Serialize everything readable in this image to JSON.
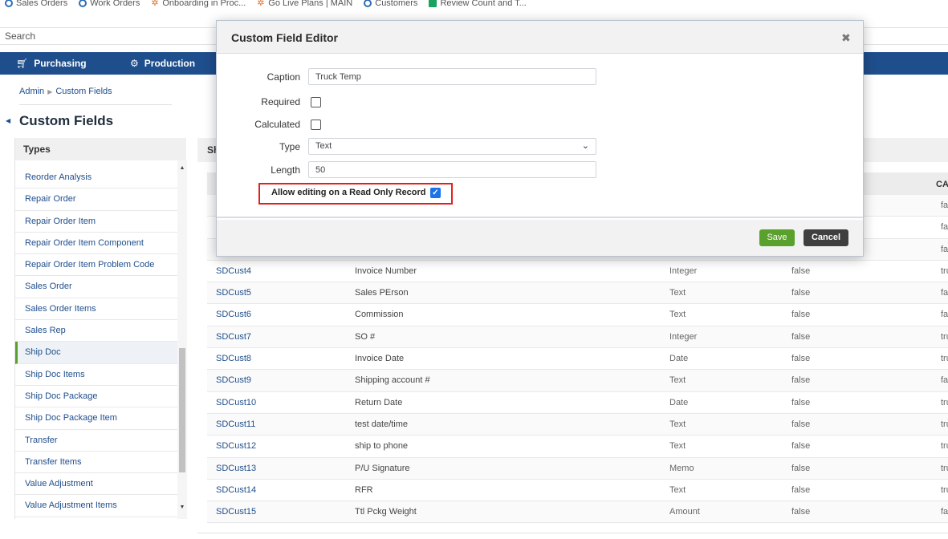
{
  "bookmarks": [
    {
      "label": "Sales Orders",
      "icon": "globe-icon"
    },
    {
      "label": "Work Orders",
      "icon": "globe-icon"
    },
    {
      "label": "Onboarding in Proc...",
      "icon": "asana-icon"
    },
    {
      "label": "Go Live Plans | MAIN",
      "icon": "asana-icon"
    },
    {
      "label": "Customers",
      "icon": "globe-icon"
    },
    {
      "label": "Review Count and T...",
      "icon": "sheets-icon"
    }
  ],
  "search": {
    "placeholder": "Search"
  },
  "nav": {
    "purchasing": {
      "label": "Purchasing",
      "icon": "cart-icon"
    },
    "production": {
      "label": "Production",
      "icon": "gears-icon"
    }
  },
  "breadcrumb": {
    "root": "Admin",
    "current": "Custom Fields"
  },
  "page_title": "Custom Fields",
  "types": {
    "header": "Types",
    "items": [
      "Reorder Analysis",
      "Repair Order",
      "Repair Order Item",
      "Repair Order Item Component",
      "Repair Order Item Problem Code",
      "Sales Order",
      "Sales Order Items",
      "Sales Rep",
      "Ship Doc",
      "Ship Doc Items",
      "Ship Doc Package",
      "Ship Doc Package Item",
      "Transfer",
      "Transfer Items",
      "Value Adjustment",
      "Value Adjustment Items"
    ],
    "active": "Ship Doc"
  },
  "right_panel": {
    "label_prefix": "Sh",
    "col_header_partial": "CAL"
  },
  "grid": {
    "rows": [
      {
        "field": "",
        "caption": "",
        "type": "",
        "required": "",
        "calculated": "fals"
      },
      {
        "field": "",
        "caption": "",
        "type": "",
        "required": "",
        "calculated": "fals"
      },
      {
        "field": "",
        "caption": "",
        "type": "",
        "required": "",
        "calculated": "fals"
      },
      {
        "field": "SDCust4",
        "caption": "Invoice Number",
        "type": "Integer",
        "required": "false",
        "calculated": "tru"
      },
      {
        "field": "SDCust5",
        "caption": "Sales PErson",
        "type": "Text",
        "required": "false",
        "calculated": "fals"
      },
      {
        "field": "SDCust6",
        "caption": "Commission",
        "type": "Text",
        "required": "false",
        "calculated": "fals"
      },
      {
        "field": "SDCust7",
        "caption": "SO #",
        "type": "Integer",
        "required": "false",
        "calculated": "tru"
      },
      {
        "field": "SDCust8",
        "caption": "Invoice Date",
        "type": "Date",
        "required": "false",
        "calculated": "tru"
      },
      {
        "field": "SDCust9",
        "caption": "Shipping account #",
        "type": "Text",
        "required": "false",
        "calculated": "fals"
      },
      {
        "field": "SDCust10",
        "caption": "Return Date",
        "type": "Date",
        "required": "false",
        "calculated": "tru"
      },
      {
        "field": "SDCust11",
        "caption": "test date/time",
        "type": "Text",
        "required": "false",
        "calculated": "tru"
      },
      {
        "field": "SDCust12",
        "caption": "ship to phone",
        "type": "Text",
        "required": "false",
        "calculated": "tru"
      },
      {
        "field": "SDCust13",
        "caption": "P/U Signature",
        "type": "Memo",
        "required": "false",
        "calculated": "tru"
      },
      {
        "field": "SDCust14",
        "caption": "RFR",
        "type": "Text",
        "required": "false",
        "calculated": "tru"
      },
      {
        "field": "SDCust15",
        "caption": "Ttl Pckg Weight",
        "type": "Amount",
        "required": "false",
        "calculated": "fals"
      }
    ]
  },
  "modal": {
    "title": "Custom Field Editor",
    "close_glyph": "✖",
    "caption_label": "Caption",
    "caption_value": "Truck Temp",
    "required_label": "Required",
    "required_checked": false,
    "calculated_label": "Calculated",
    "calculated_checked": false,
    "type_label": "Type",
    "type_value": "Text",
    "length_label": "Length",
    "length_value": "50",
    "readonly_label": "Allow editing on a Read Only Record",
    "readonly_checked": true,
    "save_label": "Save",
    "cancel_label": "Cancel"
  },
  "colors": {
    "navbar": "#1f4e8c",
    "save": "#5aa02c",
    "cancel": "#3f3f3f",
    "highlight": "#e5201c",
    "checkbox": "#1a73e8"
  }
}
